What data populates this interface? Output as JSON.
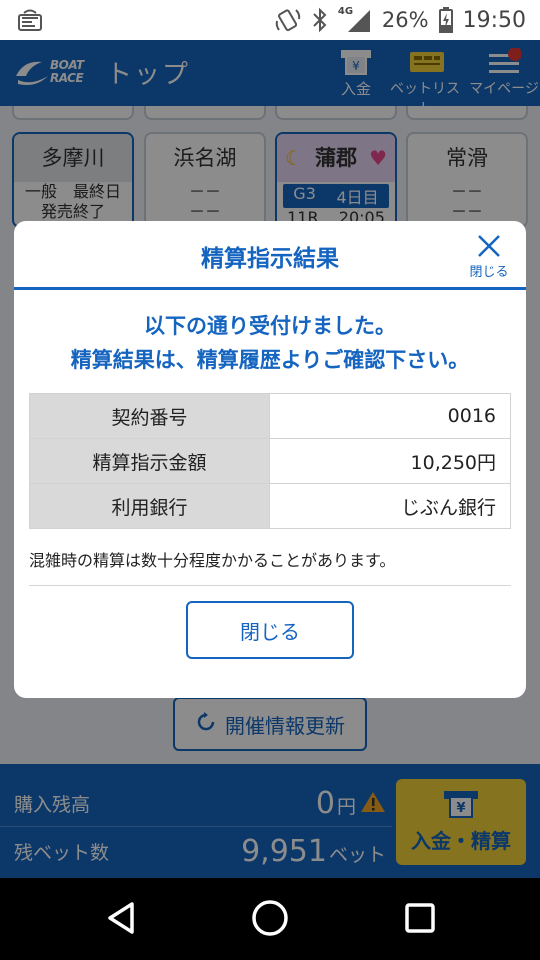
{
  "status_bar": {
    "network": "4G",
    "battery": "26%",
    "time": "19:50"
  },
  "header": {
    "logo_line1": "BOAT",
    "logo_line2": "RACE",
    "title": "トップ",
    "deposit_label": "入金",
    "betlist_label": "ベットリスト",
    "mypage_label": "マイページ"
  },
  "venues": [
    {
      "name": "多摩川",
      "line1": "一般　最終日",
      "line2": "発売終了"
    },
    {
      "name": "浜名湖",
      "line1": "－－",
      "line2": "－－"
    },
    {
      "name": "蒲郡",
      "grade": "G3",
      "day": "4日目",
      "race": "11R",
      "time": "20:05"
    },
    {
      "name": "常滑",
      "line1": "－－",
      "line2": "－－"
    }
  ],
  "refresh_label": "開催情報更新",
  "balance": {
    "purchase_label": "購入残高",
    "purchase_value": "0",
    "purchase_unit": "円",
    "bets_label": "残ベット数",
    "bets_value": "9,951",
    "bets_unit": "ベット",
    "deposit_button": "入金・精算"
  },
  "modal": {
    "title": "精算指示結果",
    "close_x_label": "閉じる",
    "message_line1": "以下の通り受付けました。",
    "message_line2": "精算結果は、精算履歴よりご確認下さい。",
    "rows": [
      {
        "key": "契約番号",
        "value": "0016"
      },
      {
        "key": "精算指示金額",
        "value": "10,250円"
      },
      {
        "key": "利用銀行",
        "value": "じぶん銀行"
      }
    ],
    "note": "混雑時の精算は数十分程度かかることがあります。",
    "close_button": "閉じる"
  },
  "colors": {
    "primary": "#1565c0",
    "accent_yellow": "#f2d13a",
    "warning": "#f5a623",
    "notification": "#e53935"
  }
}
